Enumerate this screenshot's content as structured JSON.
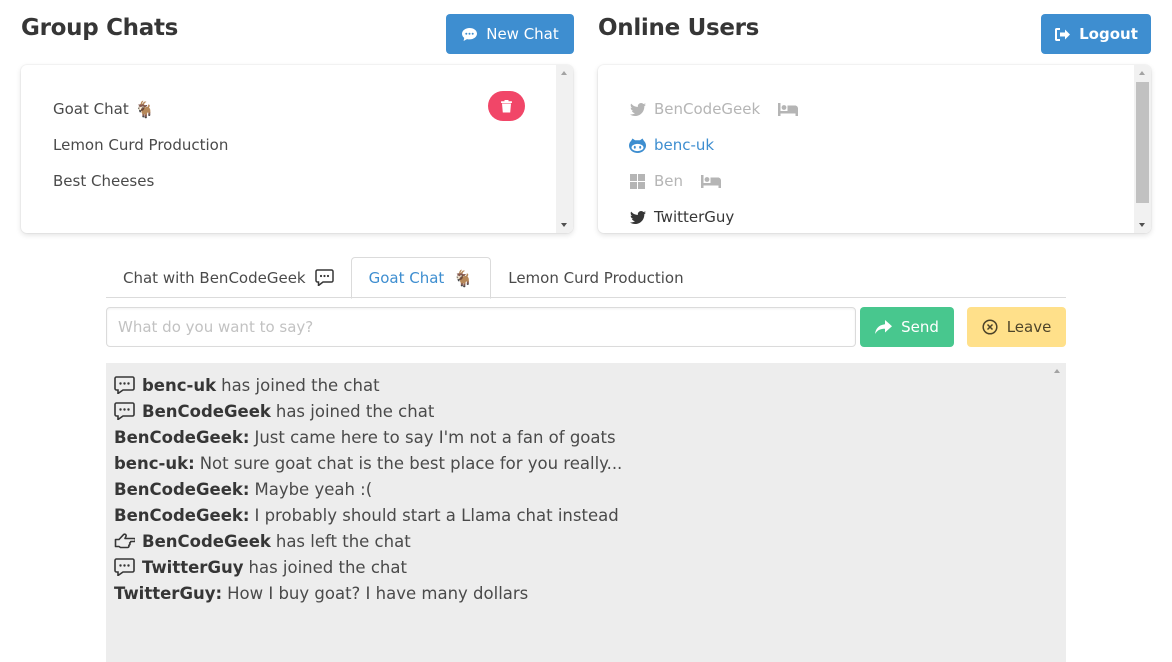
{
  "group_chats": {
    "title": "Group Chats",
    "new_chat_label": "New Chat",
    "items": [
      {
        "label": "Goat Chat",
        "emoji": "🐐",
        "deletable": true
      },
      {
        "label": "Lemon Curd Production",
        "emoji": "",
        "deletable": false
      },
      {
        "label": "Best Cheeses",
        "emoji": "",
        "deletable": false
      }
    ]
  },
  "online_users": {
    "title": "Online Users",
    "logout_label": "Logout",
    "users": [
      {
        "name": "BenCodeGeek",
        "icon": "twitter-icon",
        "color": "#b5b5b5",
        "away": true
      },
      {
        "name": "benc-uk",
        "icon": "github-icon",
        "color": "#3e8ed0",
        "away": false
      },
      {
        "name": "Ben",
        "icon": "microsoft-icon",
        "color": "#b5b5b5",
        "away": true
      },
      {
        "name": "TwitterGuy",
        "icon": "twitter-icon",
        "color": "#363636",
        "away": false
      }
    ]
  },
  "tabs": [
    {
      "label": "Chat with BenCodeGeek",
      "icon": "speech-bubble-icon",
      "active": false
    },
    {
      "label": "Goat Chat",
      "icon": "goat-emoji",
      "emoji": "🐐",
      "active": true
    },
    {
      "label": "Lemon Curd Production",
      "icon": "",
      "active": false
    }
  ],
  "composer": {
    "placeholder": "What do you want to say?",
    "send_label": "Send",
    "leave_label": "Leave"
  },
  "messages": [
    {
      "icon": "speech-bubble-icon",
      "user": "benc-uk",
      "sep": "",
      "text": "has joined the chat"
    },
    {
      "icon": "speech-bubble-icon",
      "user": "BenCodeGeek",
      "sep": "",
      "text": "has joined the chat"
    },
    {
      "icon": "",
      "user": "BenCodeGeek",
      "sep": ":",
      "text": "Just came here to say I'm not a fan of goats"
    },
    {
      "icon": "",
      "user": "benc-uk",
      "sep": ":",
      "text": "Not sure goat chat is the best place for you really..."
    },
    {
      "icon": "",
      "user": "BenCodeGeek",
      "sep": ":",
      "text": "Maybe yeah :("
    },
    {
      "icon": "",
      "user": "BenCodeGeek",
      "sep": ":",
      "text": "I probably should start a Llama chat instead"
    },
    {
      "icon": "hand-left-icon",
      "user": "BenCodeGeek",
      "sep": "",
      "text": "has left the chat"
    },
    {
      "icon": "speech-bubble-icon",
      "user": "TwitterGuy",
      "sep": "",
      "text": "has joined the chat"
    },
    {
      "icon": "",
      "user": "TwitterGuy",
      "sep": ":",
      "text": "How I buy goat? I have many dollars"
    }
  ],
  "colors": {
    "info": "#3e8ed0",
    "danger": "#f14668",
    "success": "#48c78e",
    "warning": "#ffe08a"
  }
}
